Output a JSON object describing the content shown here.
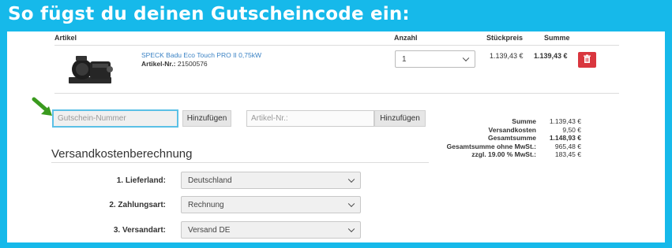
{
  "banner": {
    "title": "So fügst du deinen Gutscheincode ein:"
  },
  "colors": {
    "banner": "#16b9ea",
    "link": "#3a82c4",
    "delete": "#d9363e",
    "arrow": "#3a9a1e",
    "focus": "#5bc0e6"
  },
  "cart": {
    "headers": {
      "article": "Artikel",
      "quantity": "Anzahl",
      "unit_price": "Stückpreis",
      "total": "Summe"
    },
    "item": {
      "name": "SPECK Badu Eco Touch PRO II 0,75kW",
      "article_no_label": "Artikel-Nr.:",
      "article_no": "21500576",
      "quantity": "1",
      "unit_price": "1.139,43 €",
      "total": "1.139,43 €",
      "image_icon": "pool-pump-image",
      "delete_icon": "trash-icon"
    }
  },
  "voucher": {
    "placeholder": "Gutschein-Nummer",
    "add_label": "Hinzufügen",
    "arrow_icon": "arrow-pointer-icon"
  },
  "article_add": {
    "placeholder": "Artikel-Nr.:",
    "add_label": "Hinzufügen"
  },
  "shipping": {
    "title": "Versandkostenberechnung",
    "fields": [
      {
        "label": "1. Lieferland:",
        "value": "Deutschland"
      },
      {
        "label": "2. Zahlungsart:",
        "value": "Rechnung"
      },
      {
        "label": "3. Versandart:",
        "value": "Versand DE"
      }
    ]
  },
  "totals": [
    {
      "label": "Summe",
      "value": "1.139,43 €"
    },
    {
      "label": "Versandkosten",
      "value": "9,50 €"
    },
    {
      "label": "Gesamtsumme",
      "value": "1.148,93 €"
    },
    {
      "label": "Gesamtsumme ohne MwSt.:",
      "value": "965,48 €"
    },
    {
      "label": "zzgl. 19.00 % MwSt.:",
      "value": "183,45 €"
    }
  ]
}
